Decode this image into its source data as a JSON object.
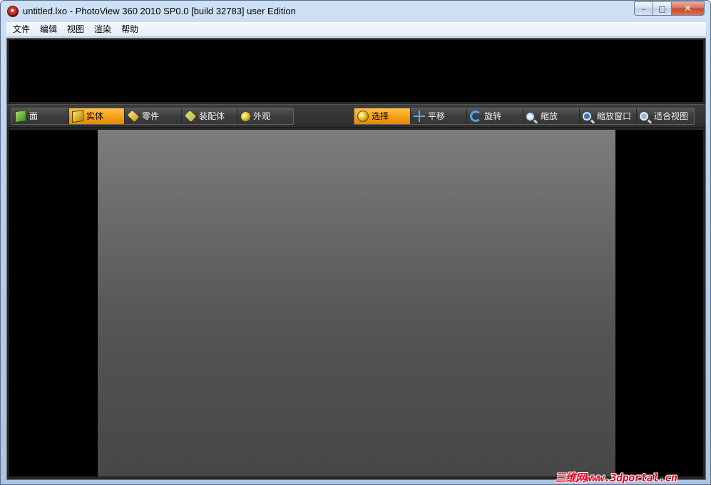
{
  "window": {
    "title": "untitled.lxo - PhotoView 360 2010 SP0.0 [build 32783] user Edition",
    "app_icon": "photoview-app-icon",
    "caption_buttons": {
      "minimize": "–",
      "maximize": "□",
      "close": "✕"
    }
  },
  "menubar": {
    "items": [
      "文件",
      "编辑",
      "视图",
      "渲染",
      "帮助"
    ]
  },
  "toolbar": {
    "selection_filters": [
      {
        "label": "面",
        "icon": "face-cube-icon",
        "active": false
      },
      {
        "label": "实体",
        "icon": "solid-cube-icon",
        "active": true
      },
      {
        "label": "零件",
        "icon": "part-icon",
        "active": false
      },
      {
        "label": "装配体",
        "icon": "assembly-icon",
        "active": false
      },
      {
        "label": "外观",
        "icon": "appearance-sphere-icon",
        "active": false
      }
    ],
    "view_tools": [
      {
        "label": "选择",
        "icon": "select-icon",
        "active": true
      },
      {
        "label": "平移",
        "icon": "pan-icon",
        "active": false
      },
      {
        "label": "旋转",
        "icon": "rotate-icon",
        "active": false
      },
      {
        "label": "缩放",
        "icon": "zoom-icon",
        "active": false
      },
      {
        "label": "缩放窗口",
        "icon": "zoom-window-icon",
        "active": false
      },
      {
        "label": "适合视图",
        "icon": "zoom-fit-icon",
        "active": false
      }
    ]
  },
  "watermark": {
    "text": "三维网www.3dportal.cn"
  },
  "colors": {
    "active_button": "#f5a216",
    "toolbar_bg": "#333333",
    "viewport_bg": "#000000",
    "watermark": "#e6001d"
  }
}
